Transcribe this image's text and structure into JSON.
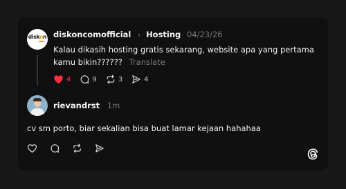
{
  "post": {
    "username": "diskoncomofficial",
    "topic": "Hosting",
    "date": "04/23/26",
    "text": "Kalau dikasih hosting gratis sekarang, website apa yang pertama kamu bikin??????",
    "translate_label": "Translate",
    "avatar_logo_text": "diskon",
    "likes": "4",
    "replies": "9",
    "reposts": "3",
    "shares": "4",
    "like_color": "#ff3040"
  },
  "reply": {
    "username": "rievandrst",
    "time": "1m",
    "text": "cv sm porto, biar sekalian bisa buat lamar kejaan hahahaa"
  },
  "icons": {
    "heart": "heart-icon",
    "comment": "comment-icon",
    "repost": "repost-icon",
    "share": "share-icon",
    "threads": "threads-logo-icon"
  }
}
